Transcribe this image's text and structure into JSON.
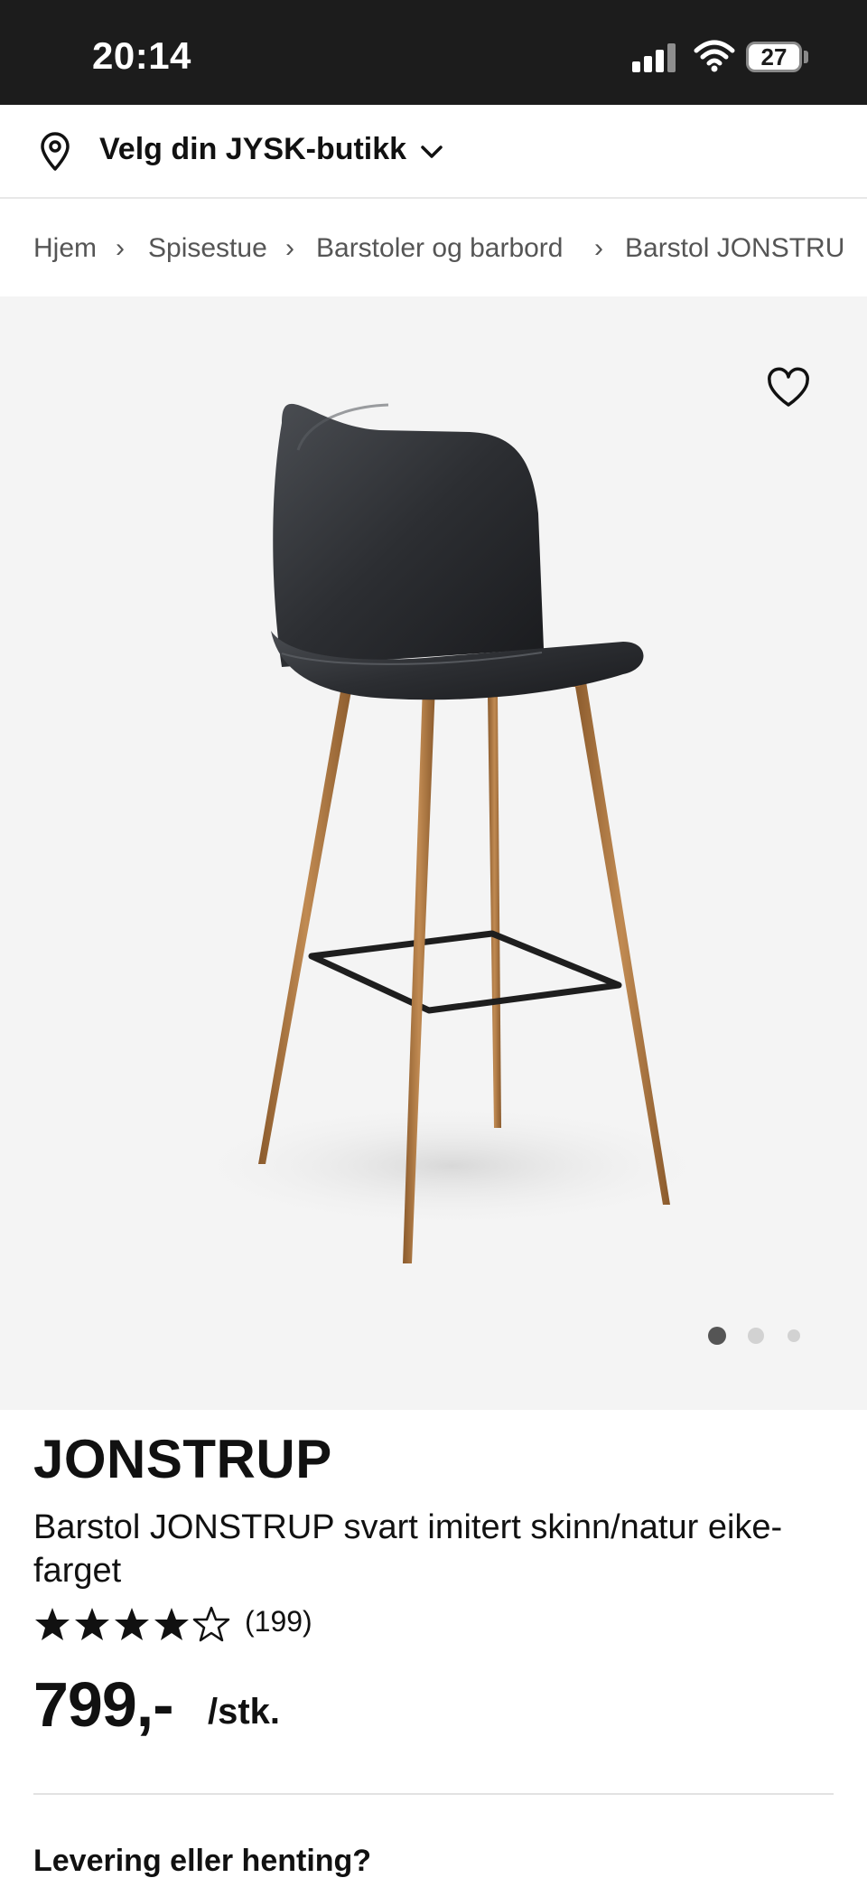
{
  "status_bar": {
    "time": "20:14",
    "battery": "27",
    "icons": [
      "signal-icon",
      "wifi-icon",
      "battery-icon"
    ]
  },
  "store_selector": {
    "label": "Velg din JYSK-butikk",
    "icon": "location-pin-icon",
    "chevron": "chevron-down-icon"
  },
  "breadcrumb": {
    "items": [
      "Hjem",
      "Spisestue",
      "Barstoler og barbord",
      "Barstol JONSTRU"
    ],
    "separator": "›"
  },
  "gallery": {
    "favorite_icon": "heart-outline-icon",
    "image_count": 3,
    "active_index": 0
  },
  "product": {
    "name": "JONSTRUP",
    "description": "Barstol JONSTRUP svart imitert skinn/natur eike-farget",
    "rating": 4,
    "rating_max": 5,
    "review_count": "(199)",
    "price": "799,-",
    "price_unit": "/stk."
  },
  "delivery": {
    "heading": "Levering eller henting?"
  },
  "colors": {
    "status_bar_bg": "#1c1c1c",
    "gallery_bg": "#f4f4f4",
    "text": "#111111",
    "breadcrumb_text": "#555555",
    "seat": "#2a2c2f",
    "legs": "#a8703a"
  }
}
